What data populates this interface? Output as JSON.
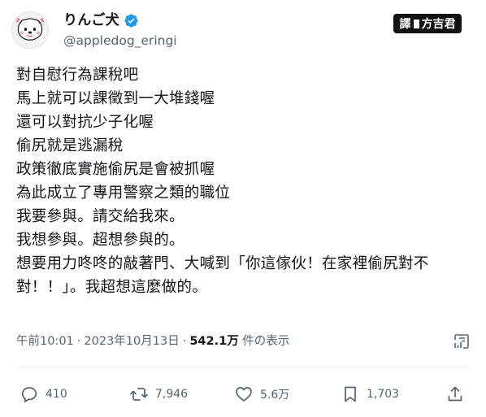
{
  "author": {
    "display_name": "りんご犬",
    "handle": "@appledog_eringi",
    "verified": true,
    "avatar_icon": "apple-dog-avatar-icon"
  },
  "translator_badge": {
    "prefix": "譯",
    "name": "方吉君"
  },
  "tweet": {
    "lines": [
      "對自慰行為課稅吧",
      "馬上就可以課徵到一大堆錢喔",
      "還可以對抗少子化喔",
      "偷尻就是逃漏稅",
      "政策徹底實施偷尻是會被抓喔",
      "為此成立了專用警察之類的職位",
      "我要參與。請交給我來。",
      "我想參與。超想參與的。",
      "想要用力咚咚的敲著門、大喊到「你這傢伙！在家裡偷尻對不",
      "對！！」。我超想這麼做的。"
    ]
  },
  "meta": {
    "time": "午前10:01",
    "separator": "·",
    "date": "2023年10月13日",
    "views_count": "542.1万",
    "views_label": "件の表示"
  },
  "actions": {
    "reply_count": "410",
    "retweet_count": "7,946",
    "like_count": "5.6万",
    "bookmark_count": "1,703"
  },
  "colors": {
    "text_primary": "#0f1419",
    "text_secondary": "#536471",
    "verified_blue": "#1d9bf0",
    "divider": "#eff3f4",
    "badge_background": "#111111"
  }
}
